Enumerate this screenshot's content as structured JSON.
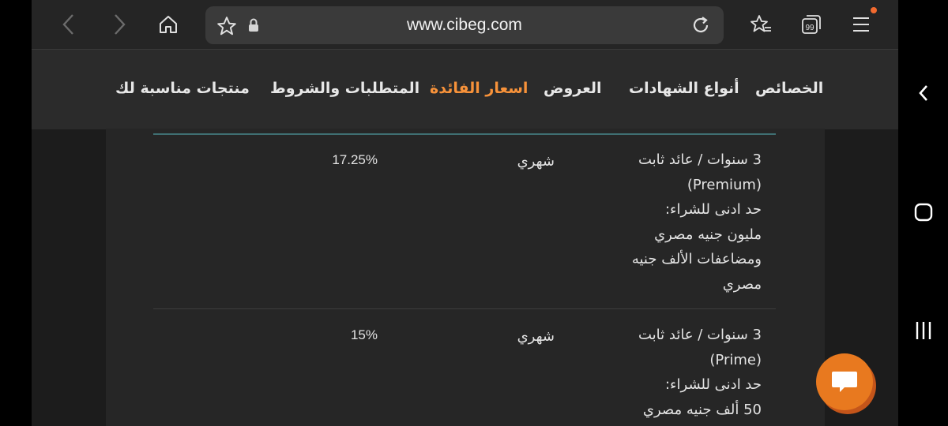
{
  "browser": {
    "url": "www.cibeg.com",
    "tab_count": "99",
    "accent_color": "#f7923a"
  },
  "nav": {
    "items": [
      {
        "label": "الخصائص",
        "active": false
      },
      {
        "label": "أنواع الشهادات",
        "active": false
      },
      {
        "label": "العروض",
        "active": false
      },
      {
        "label": "اسعار الفائدة",
        "active": true
      },
      {
        "label": "المتطلبات والشروط",
        "active": false
      },
      {
        "label": "منتجات مناسبة لك",
        "active": false
      }
    ]
  },
  "table": {
    "rows": [
      {
        "description_lines": [
          "3 سنوات / عائد ثابت",
          "(Premium)",
          "حد ادنى للشراء:",
          "مليون جنيه مصري",
          "ومضاعفات الألف جنيه",
          "مصري"
        ],
        "frequency": "شهري",
        "rate": "17.25%"
      },
      {
        "description_lines": [
          "3 سنوات / عائد ثابت",
          "(Prime)",
          "حد ادنى للشراء:",
          "50 ألف جنيه مصري"
        ],
        "frequency": "شهري",
        "rate": "15%"
      }
    ]
  }
}
